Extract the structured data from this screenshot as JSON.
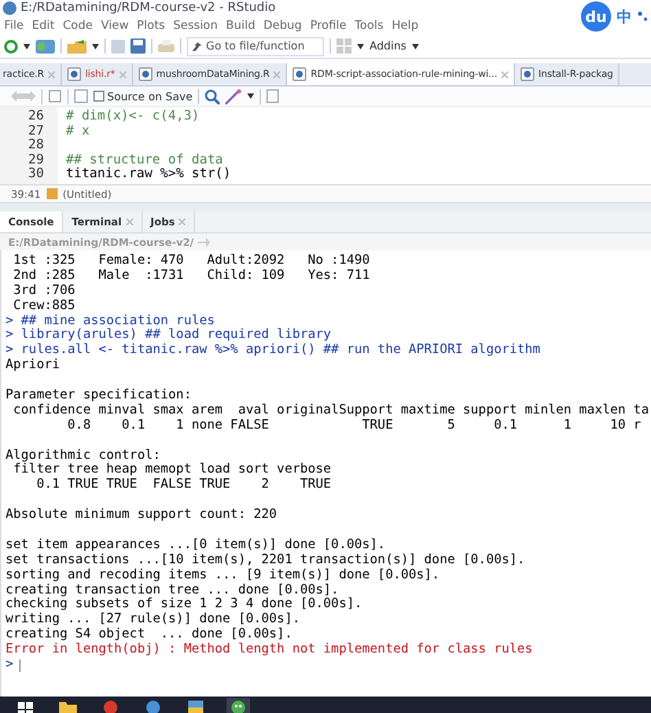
{
  "window": {
    "title": "E:/RDatamining/RDM-course-v2 - RStudio"
  },
  "ime": {
    "logo": "du",
    "mode": "中"
  },
  "menu": [
    "File",
    "Edit",
    "Code",
    "View",
    "Plots",
    "Session",
    "Build",
    "Debug",
    "Profile",
    "Tools",
    "Help"
  ],
  "toolbar": {
    "goto_placeholder": "Go to file/function",
    "addins": "Addins"
  },
  "editor_tabs": [
    {
      "label": "ractice.R",
      "selected": false,
      "modified": false,
      "icon": false
    },
    {
      "label": "lishi.r*",
      "selected": false,
      "modified": true,
      "icon": true
    },
    {
      "label": "mushroomDataMining.R",
      "selected": false,
      "modified": false,
      "icon": true
    },
    {
      "label": "RDM-script-association-rule-mining-wi...",
      "selected": true,
      "modified": false,
      "icon": true
    },
    {
      "label": "Install-R-packag",
      "selected": false,
      "modified": false,
      "icon": true
    }
  ],
  "editor_toolbar": {
    "source_on_save": {
      "label": "Source on Save",
      "checked": false
    }
  },
  "code_lines": [
    {
      "number": "26",
      "text": "# dim(x)<- c(4,3)",
      "kind": "comment"
    },
    {
      "number": "27",
      "text": "# x",
      "kind": "comment"
    },
    {
      "number": "28",
      "kind": "code"
    },
    {
      "number": "29",
      "text": "## structure of data",
      "kind": "comment"
    },
    {
      "number": "30",
      "text": "titanic.raw %>% str()",
      "kind": "code"
    }
  ],
  "editor_status": {
    "position": "39:41",
    "scope": "(Untitled)"
  },
  "console_tabs": [
    {
      "label": "Console",
      "selected": true,
      "closable": false
    },
    {
      "label": "Terminal",
      "selected": false,
      "closable": true
    },
    {
      "label": "Jobs",
      "selected": false,
      "closable": true
    }
  ],
  "console_path": "E:/RDatamining/RDM-course-v2/",
  "console_lines": [
    {
      "text": " 1st :325   Female: 470   Adult:2092   No :1490",
      "kind": "output"
    },
    {
      "text": " 2nd :285   Male  :1731   Child: 109   Yes: 711",
      "kind": "output"
    },
    {
      "text": " 3rd :706",
      "kind": "output"
    },
    {
      "text": " Crew:885",
      "kind": "output"
    },
    {
      "text": "> ## mine association rules",
      "kind": "input"
    },
    {
      "text": "> library(arules) ## load required library",
      "kind": "input"
    },
    {
      "text": "> rules.all <- titanic.raw %>% apriori() ## run the APRIORI algorithm",
      "kind": "input"
    },
    {
      "text": "Apriori",
      "kind": "output"
    },
    {
      "kind": "output"
    },
    {
      "text": "Parameter specification:",
      "kind": "output"
    },
    {
      "text": " confidence minval smax arem  aval originalSupport maxtime support minlen maxlen ta",
      "kind": "output"
    },
    {
      "text": "        0.8    0.1    1 none FALSE            TRUE       5     0.1      1     10 r",
      "kind": "output"
    },
    {
      "kind": "output"
    },
    {
      "text": "Algorithmic control:",
      "kind": "output"
    },
    {
      "text": " filter tree heap memopt load sort verbose",
      "kind": "output"
    },
    {
      "text": "    0.1 TRUE TRUE  FALSE TRUE    2    TRUE",
      "kind": "output"
    },
    {
      "kind": "output"
    },
    {
      "text": "Absolute minimum support count: 220",
      "kind": "output"
    },
    {
      "kind": "output"
    },
    {
      "text": "set item appearances ...[0 item(s)] done [0.00s].",
      "kind": "output"
    },
    {
      "text": "set transactions ...[10 item(s), 2201 transaction(s)] done [0.00s].",
      "kind": "output"
    },
    {
      "text": "sorting and recoding items ... [9 item(s)] done [0.00s].",
      "kind": "output"
    },
    {
      "text": "creating transaction tree ... done [0.00s].",
      "kind": "output"
    },
    {
      "text": "checking subsets of size 1 2 3 4 done [0.00s].",
      "kind": "output"
    },
    {
      "text": "writing ... [27 rule(s)] done [0.00s].",
      "kind": "output"
    },
    {
      "text": "creating S4 object  ... done [0.00s].",
      "kind": "output"
    },
    {
      "text": "Error in length(obj) : Method length not implemented for class rules",
      "kind": "error"
    },
    {
      "text": ">",
      "kind": "prompt"
    }
  ],
  "taskbar": {
    "apps": [
      {
        "kind": "start"
      },
      {
        "kind": "folder"
      },
      {
        "kind": "red"
      },
      {
        "kind": "blue"
      },
      {
        "kind": "files"
      },
      {
        "kind": "chat"
      }
    ]
  }
}
